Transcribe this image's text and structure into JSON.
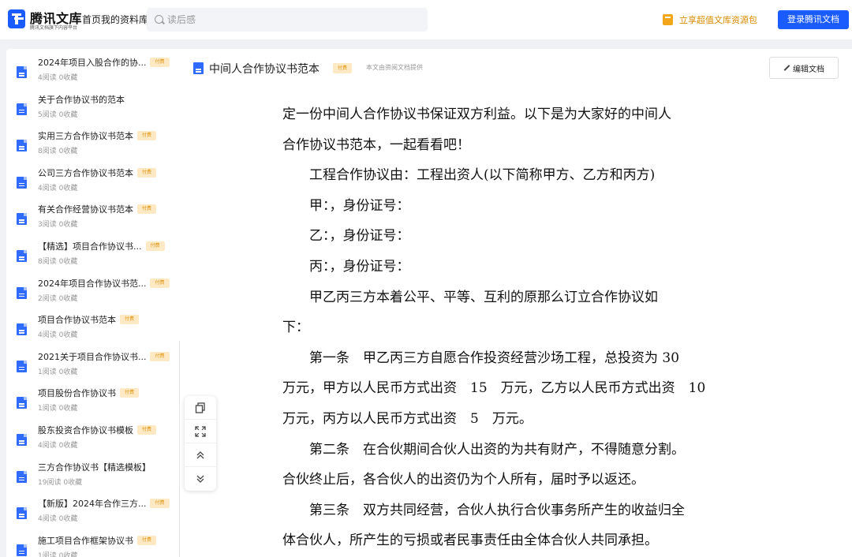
{
  "header": {
    "logo_title": "腾讯文库",
    "logo_subtitle": "腾讯文档旗下内容平台",
    "nav": [
      "首页",
      "我的资料库"
    ],
    "search_placeholder": "读后感",
    "promo_text": "立享超值文库资源包",
    "login_label": "登录腾讯文档"
  },
  "sidebar": {
    "items": [
      {
        "title": "2024年项目入股合作的协...",
        "meta": "4阅读 0收藏",
        "badge": "付费"
      },
      {
        "title": "关于合作协议书的范本",
        "meta": "5阅读 0收藏",
        "badge": ""
      },
      {
        "title": "实用三方合作协议书范本",
        "meta": "8阅读 0收藏",
        "badge": "付费"
      },
      {
        "title": "公司三方合作协议书范本",
        "meta": "4阅读 0收藏",
        "badge": "付费"
      },
      {
        "title": "有关合作经营协议书范本",
        "meta": "3阅读 0收藏",
        "badge": "付费"
      },
      {
        "title": "【精选】项目合作协议书...",
        "meta": "8阅读 0收藏",
        "badge": "付费"
      },
      {
        "title": "2024年项目合作协议书范...",
        "meta": "2阅读 0收藏",
        "badge": "付费"
      },
      {
        "title": "项目合作协议书范本",
        "meta": "4阅读 0收藏",
        "badge": "付费"
      },
      {
        "title": "2021关于项目合作协议书...",
        "meta": "1阅读 0收藏",
        "badge": "付费"
      },
      {
        "title": "项目股份合作协议书",
        "meta": "1阅读 0收藏",
        "badge": "付费"
      },
      {
        "title": "股东投资合作协议书模板",
        "meta": "4阅读 0收藏",
        "badge": "付费"
      },
      {
        "title": "三方合作协议书【精选模板】",
        "meta": "19阅读 0收藏",
        "badge": ""
      },
      {
        "title": "【新版】2024年合作三方...",
        "meta": "4阅读 0收藏",
        "badge": "付费"
      },
      {
        "title": "施工项目合作框架协议书",
        "meta": "1阅读 0收藏",
        "badge": "付费"
      }
    ]
  },
  "content": {
    "title": "中间人合作协议书范本",
    "badge": "付费",
    "source": "本文由资阅文档提供",
    "edit_label": "编辑文档",
    "paragraphs": [
      "定一份中间人合作协议书保证双方利益。以下是为大家好的中间人",
      "合作协议书范本，一起看看吧！",
      "　　工程合作协议由：工程出资人(以下简称甲方、乙方和丙方)",
      "　　甲：，身份证号：",
      "　　乙：，身份证号：",
      "　　丙：，身份证号：",
      "　　甲乙丙三方本着公平、平等、互利的原那么订立合作协议如",
      "下：",
      "　　第一条　甲乙丙三方自愿合作投资经营沙场工程，总投资为 30",
      "万元，甲方以人民币方式出资　15　万元，乙方以人民币方式出资　10",
      "万元，丙方以人民币方式出资　5　万元。",
      "　　第二条　在合伙期间合伙人出资的为共有财产，不得随意分割。",
      "合伙终止后，各合伙人的出资仍为个人所有，届时予以返还。",
      "　　第三条　双方共同经营，合伙人执行合伙事务所产生的收益归全",
      "体合伙人，所产生的亏损或者民事责任由全体合伙人共同承担。"
    ]
  },
  "float_toolbar": {
    "icons": [
      "copy-icon",
      "fullscreen-icon",
      "scroll-up-icon",
      "scroll-down-icon"
    ]
  },
  "colors": {
    "brand": "#1a5cff",
    "promo": "#d98b00",
    "badge_bg": "#fde9c4",
    "badge_text": "#e09410"
  }
}
